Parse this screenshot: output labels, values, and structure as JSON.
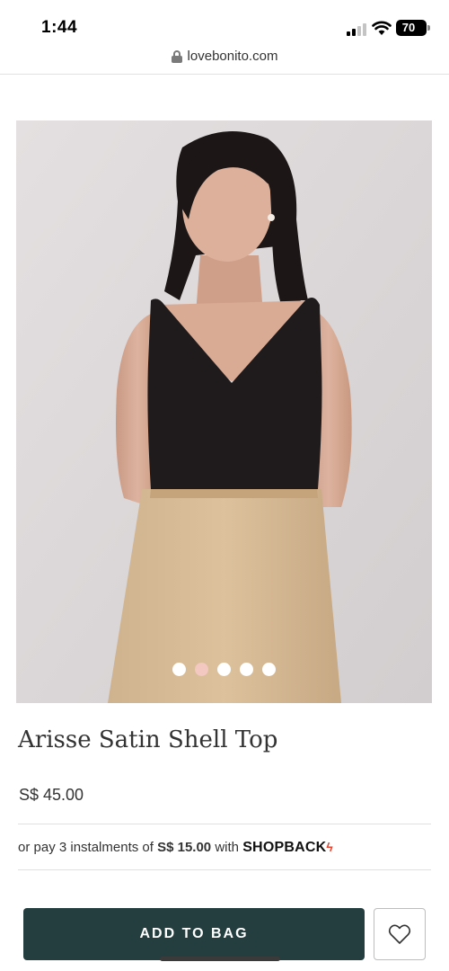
{
  "status_bar": {
    "time": "1:44",
    "battery": "70"
  },
  "browser": {
    "url": "lovebonito.com",
    "icon": "lock-icon"
  },
  "product": {
    "image_alt": "Model wearing black satin shell top with beige skirt",
    "carousel": {
      "total": 5,
      "active_index": 1
    },
    "name": "Arisse Satin Shell Top",
    "price": "S$ 45.00"
  },
  "instalment": {
    "prefix": "or pay 3 instalments of",
    "amount": "S$ 15.00",
    "with": "with",
    "provider": "SHOPBACK"
  },
  "actions": {
    "add_to_bag": "ADD TO BAG",
    "wishlist_icon": "heart-icon"
  },
  "colors": {
    "primary_button": "#243d3f",
    "active_dot": "#f3c8c0",
    "shopback_bolt": "#e8432e"
  }
}
